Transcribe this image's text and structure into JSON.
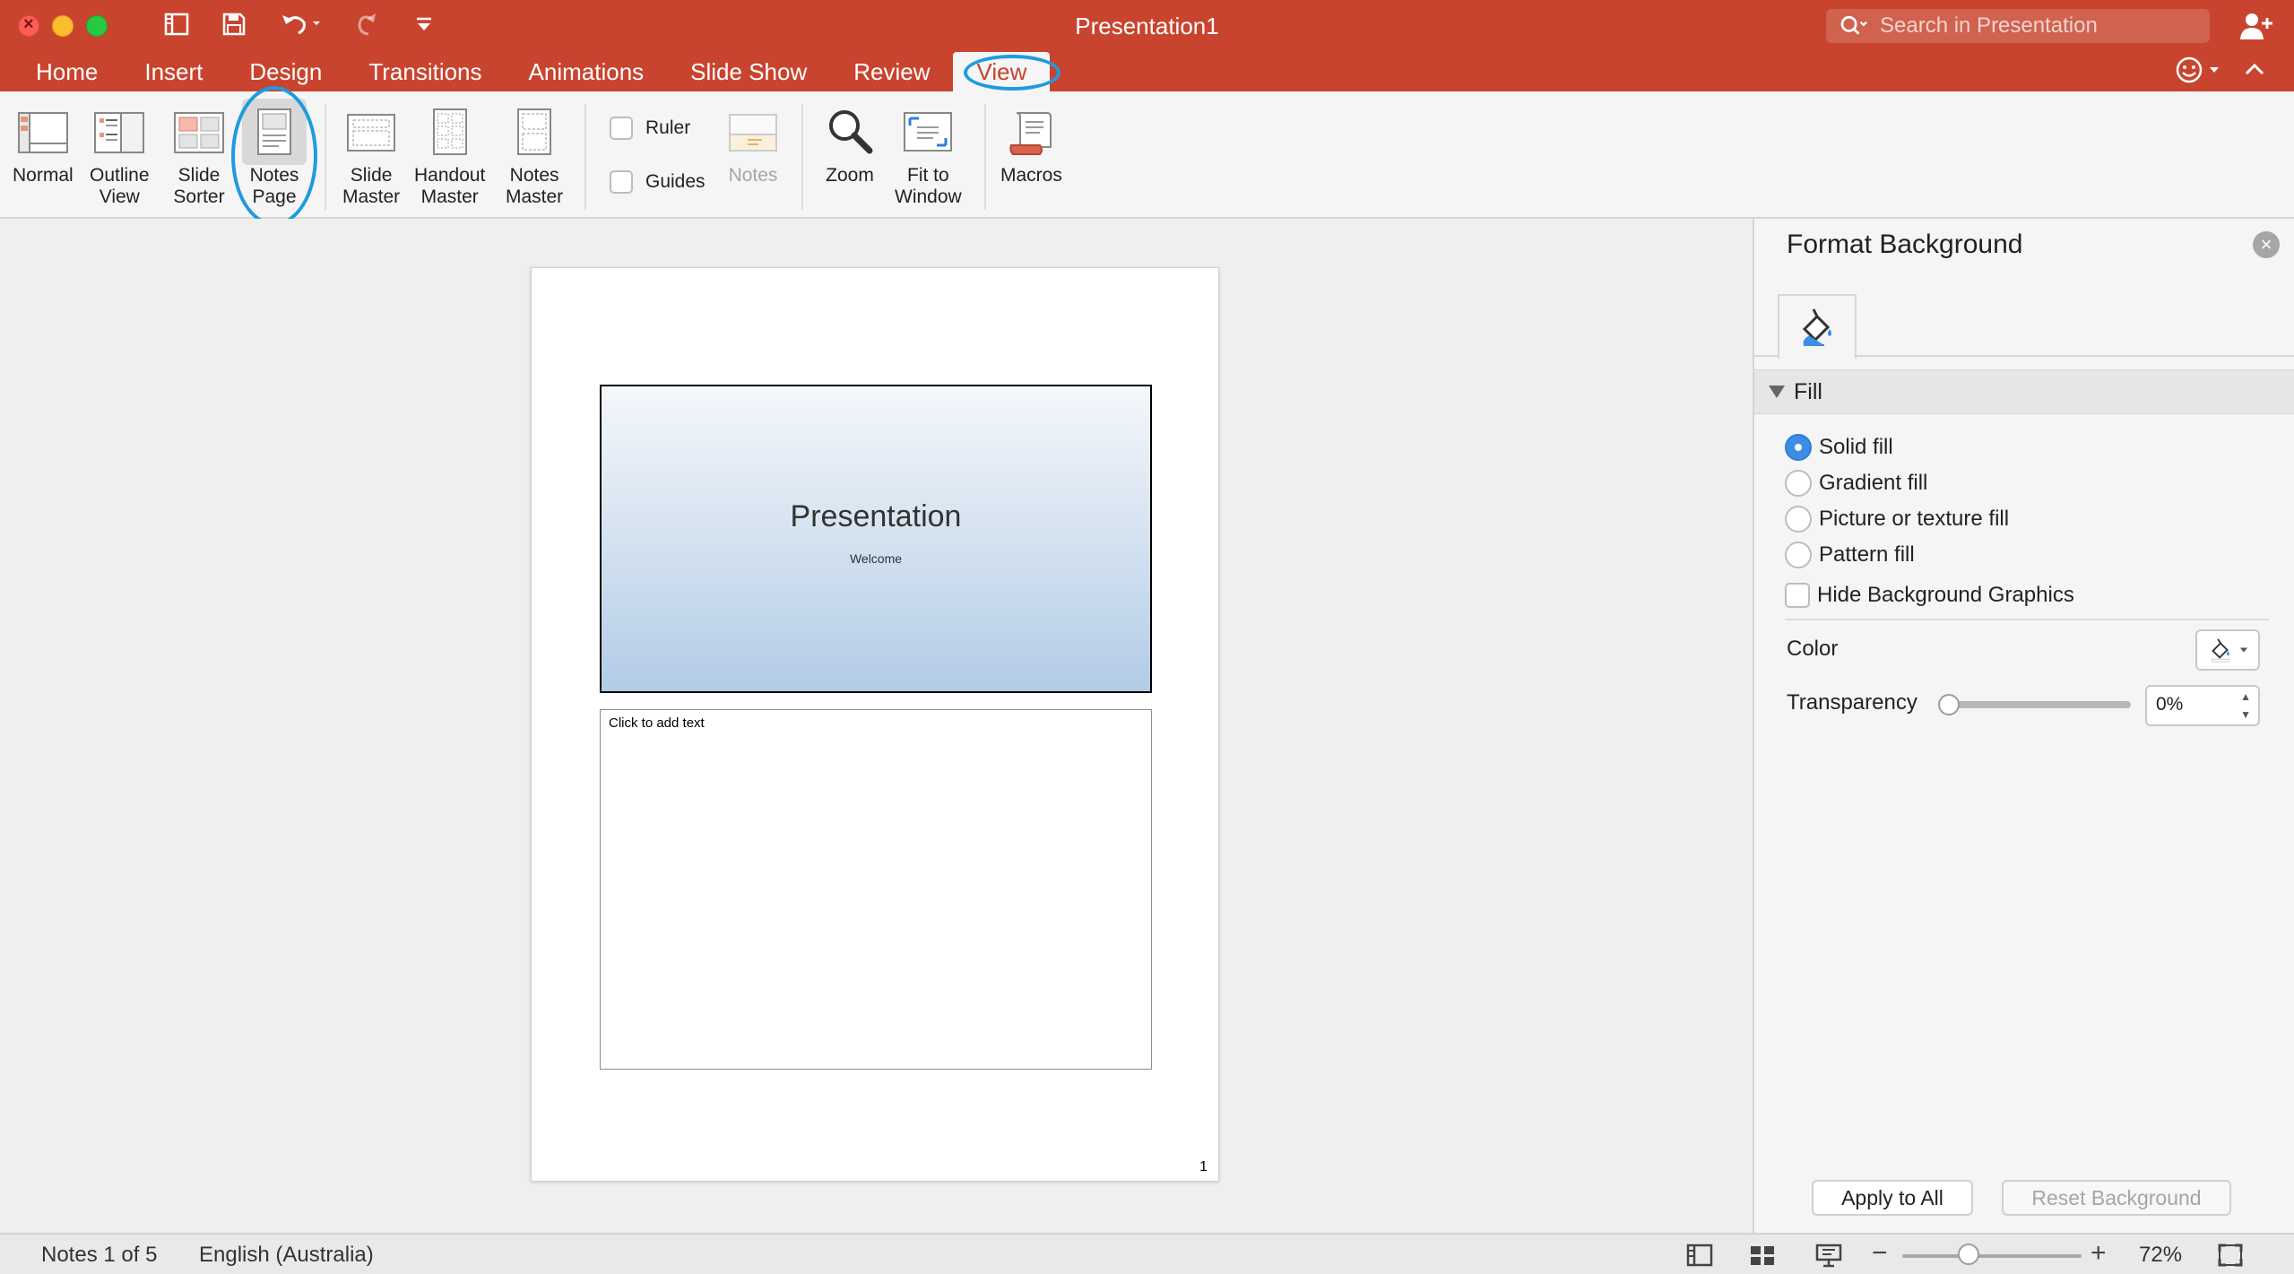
{
  "window": {
    "title": "Presentation1",
    "search_placeholder": "Search in Presentation"
  },
  "tabs": [
    {
      "label": "Home"
    },
    {
      "label": "Insert"
    },
    {
      "label": "Design"
    },
    {
      "label": "Transitions"
    },
    {
      "label": "Animations"
    },
    {
      "label": "Slide Show"
    },
    {
      "label": "Review"
    },
    {
      "label": "View",
      "active": true
    }
  ],
  "ribbon": {
    "normal": [
      "Normal",
      ""
    ],
    "outline": [
      "Outline",
      "View"
    ],
    "sorter": [
      "Slide",
      "Sorter"
    ],
    "notes_page": [
      "Notes",
      "Page"
    ],
    "slide_master": [
      "Slide",
      "Master"
    ],
    "handout_master": [
      "Handout",
      "Master"
    ],
    "notes_master": [
      "Notes",
      "Master"
    ],
    "ruler": "Ruler",
    "guides": "Guides",
    "notes": "Notes",
    "zoom": "Zoom",
    "fit_window": [
      "Fit to",
      "Window"
    ],
    "macros": "Macros"
  },
  "slide": {
    "title": "Presentation",
    "subtitle": "Welcome",
    "notes_placeholder": "Click to add text",
    "page_number": "1"
  },
  "pane": {
    "title": "Format Background",
    "section": "Fill",
    "options": [
      "Solid fill",
      "Gradient fill",
      "Picture or texture fill",
      "Pattern fill"
    ],
    "selected_option": "Solid fill",
    "hide_graphics": "Hide Background Graphics",
    "color_label": "Color",
    "transparency_label": "Transparency",
    "transparency_value": "0%",
    "transparency_fraction": 0,
    "apply_all": "Apply to All",
    "reset": "Reset Background"
  },
  "status": {
    "slide_info": "Notes 1 of 5",
    "language": "English (Australia)",
    "zoom": "72%"
  },
  "colors": {
    "accent": "#c9442e",
    "highlight_ring": "#1e9be0",
    "radio_selected": "#3b8de6"
  }
}
